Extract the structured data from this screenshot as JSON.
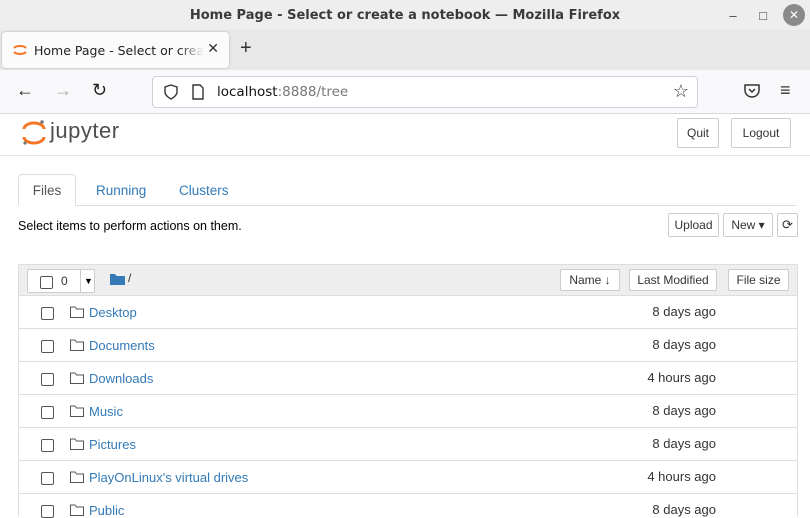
{
  "window": {
    "title": "Home Page - Select or create a notebook — Mozilla Firefox",
    "minimize": "–",
    "maximize": "□",
    "close": "✕"
  },
  "browser": {
    "tab_title": "Home Page - Select or create a notebook",
    "tab_close": "✕",
    "new_tab": "+",
    "back": "←",
    "forward": "→",
    "reload": "↻",
    "url_host": "localhost",
    "url_rest": ":8888/tree",
    "bookmark": "☆",
    "menu": "≡"
  },
  "jupyter": {
    "brand": "jupyter",
    "quit_label": "Quit",
    "logout_label": "Logout",
    "tabs": [
      {
        "label": "Files"
      },
      {
        "label": "Running"
      },
      {
        "label": "Clusters"
      }
    ],
    "hint": "Select items to perform actions on them.",
    "upload_label": "Upload",
    "new_label": "New ▾",
    "refresh_icon": "⟳",
    "list": {
      "selected_count": "0",
      "dropdown": "▼",
      "breadcrumb": "/",
      "col_name": "Name ↓",
      "col_modified": "Last Modified",
      "col_size": "File size",
      "items": [
        {
          "name": "Desktop",
          "modified": "8 days ago"
        },
        {
          "name": "Documents",
          "modified": "8 days ago"
        },
        {
          "name": "Downloads",
          "modified": "4 hours ago"
        },
        {
          "name": "Music",
          "modified": "8 days ago"
        },
        {
          "name": "Pictures",
          "modified": "8 days ago"
        },
        {
          "name": "PlayOnLinux's virtual drives",
          "modified": "4 hours ago"
        },
        {
          "name": "Public",
          "modified": "8 days ago"
        }
      ]
    }
  }
}
